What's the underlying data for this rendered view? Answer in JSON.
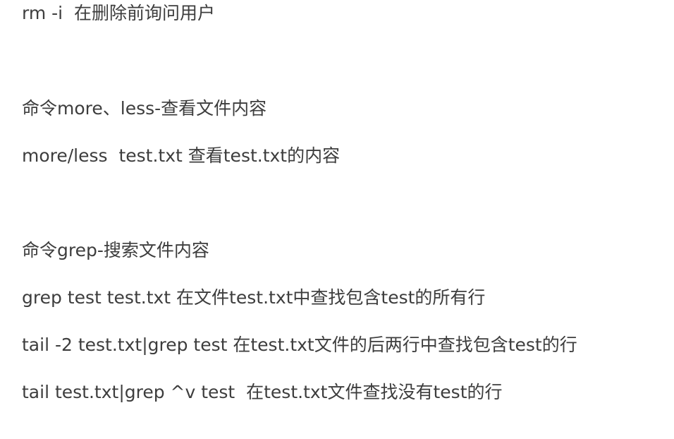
{
  "lines": [
    "rm -i  在删除前询问用户",
    "命令more、less-查看文件内容",
    "more/less  test.txt 查看test.txt的内容",
    "命令grep-搜索文件内容",
    "grep test test.txt 在文件test.txt中查找包含test的所有行",
    "tail -2 test.txt|grep test 在test.txt文件的后两行中查找包含test的行",
    "tail test.txt|grep ^v test  在test.txt文件查找没有test的行"
  ]
}
